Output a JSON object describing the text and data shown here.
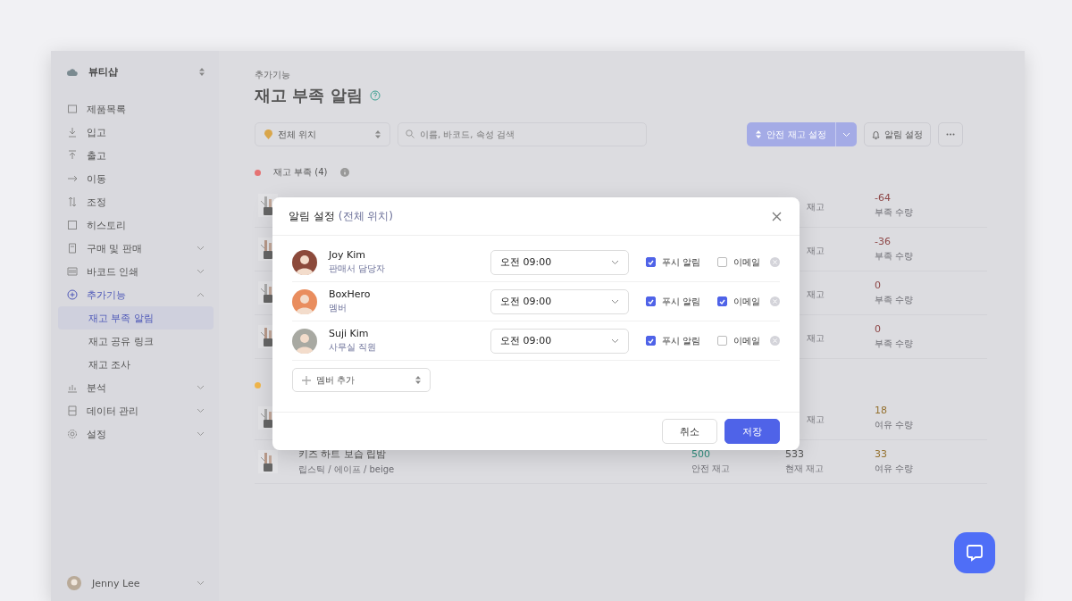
{
  "workspace": {
    "name": "뷰티샵"
  },
  "nav": [
    {
      "kind": "link",
      "label": "제품목록",
      "selected": false
    },
    {
      "kind": "link",
      "label": "입고",
      "selected": false
    },
    {
      "kind": "link",
      "label": "출고",
      "selected": false
    },
    {
      "kind": "link",
      "label": "이동",
      "selected": false
    },
    {
      "kind": "link",
      "label": "조정",
      "selected": false
    },
    {
      "kind": "link",
      "label": "히스토리",
      "selected": false
    },
    {
      "kind": "group",
      "label": "구매 및 판매",
      "expanded": false,
      "selected": false
    },
    {
      "kind": "group",
      "label": "바코드 인쇄",
      "expanded": false,
      "selected": false
    },
    {
      "kind": "group",
      "label": "추가기능",
      "expanded": true,
      "selected": true,
      "children": [
        {
          "label": "재고 부족 알림",
          "selected": true
        },
        {
          "label": "재고 공유 링크",
          "selected": false
        },
        {
          "label": "재고 조사",
          "selected": false
        }
      ]
    },
    {
      "kind": "group",
      "label": "분석",
      "expanded": false,
      "selected": false
    },
    {
      "kind": "group",
      "label": "데이터 관리",
      "expanded": false,
      "selected": false
    },
    {
      "kind": "group",
      "label": "설정",
      "expanded": false,
      "selected": false
    }
  ],
  "user": {
    "name": "Jenny Lee"
  },
  "page": {
    "breadcrumb": "추가기능",
    "title": "재고 부족 알림"
  },
  "toolbar": {
    "location": "전체 위치",
    "search": {
      "placeholder": "이름, 바코드, 속성 검색"
    },
    "primary": "안전 재고 설정",
    "alarm": "알림 설정"
  },
  "sections": [
    {
      "title": "재고 부족 (4)",
      "color": "#e57373",
      "rows": [
        {
          "current_label": "재고",
          "diff": "-64",
          "diff_label": "부족 수량"
        },
        {
          "current_label": "재고",
          "diff": "-36",
          "diff_label": "부족 수량"
        },
        {
          "current_label": "재고",
          "diff": "0",
          "diff_label": "부족 수량"
        },
        {
          "current_label": "재고",
          "diff": "0",
          "diff_label": "부족 수량"
        }
      ]
    },
    {
      "color": "#f0b64b",
      "rows": [
        {
          "current_label": "재고",
          "diff": "18",
          "diff_label": "여유 수량"
        },
        {
          "name": "키즈 하트 보습 립밤",
          "variant": "립스틱 / 에이프 / beige",
          "safe": "500",
          "safe_label": "안전 재고",
          "current": "533",
          "current_label": "현재 재고",
          "diff": "33",
          "diff_label": "여유 수량"
        }
      ]
    }
  ],
  "modal": {
    "title": "알림 설정",
    "subtitle": "(전체 위치)",
    "members": [
      {
        "name": "Joy Kim",
        "role": "판매서 담당자",
        "time": "오전 09:00",
        "push": {
          "label": "푸시 알림",
          "checked": true
        },
        "email": {
          "label": "이메일",
          "checked": false
        }
      },
      {
        "name": "BoxHero",
        "role": "멤버",
        "time": "오전 09:00",
        "push": {
          "label": "푸시 알림",
          "checked": true
        },
        "email": {
          "label": "이메일",
          "checked": true
        }
      },
      {
        "name": "Suji Kim",
        "role": "사무실 직원",
        "time": "오전 09:00",
        "push": {
          "label": "푸시 알림",
          "checked": true
        },
        "email": {
          "label": "이메일",
          "checked": false
        }
      }
    ],
    "add_member": "멤버 추가",
    "cancel": "취소",
    "save": "저장"
  }
}
